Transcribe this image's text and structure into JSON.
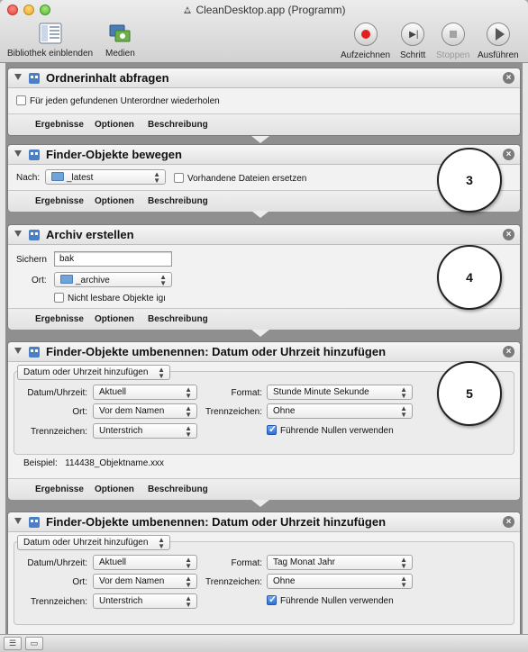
{
  "window": {
    "title": "CleanDesktop.app (Programm)"
  },
  "toolbar": {
    "library": "Bibliothek einblenden",
    "media": "Medien",
    "record": "Aufzeichnen",
    "step": "Schritt",
    "stop": "Stoppen",
    "run": "Ausführen"
  },
  "footer_tabs": {
    "results": "Ergebnisse",
    "options": "Optionen",
    "description": "Beschreibung"
  },
  "action1": {
    "title": "Ordnerinhalt abfragen",
    "repeat_checkbox": "Für jeden gefundenen Unterordner wiederholen",
    "repeat_checked": false
  },
  "action2": {
    "title": "Finder-Objekte bewegen",
    "to_label": "Nach:",
    "to_value": "_latest",
    "replace_checkbox": "Vorhandene Dateien ersetzen",
    "replace_checked": false,
    "step_number": "3"
  },
  "action3": {
    "title": "Archiv erstellen",
    "save_label": "Sichern",
    "save_value": "bak",
    "location_label": "Ort:",
    "location_value": "_archive",
    "unreadable_checkbox": "Nicht lesbare Objekte igı",
    "unreadable_checked": false,
    "step_number": "4"
  },
  "action4": {
    "title": "Finder-Objekte umbenennen: Datum oder Uhrzeit hinzufügen",
    "mode": "Datum oder Uhrzeit hinzufügen",
    "datetime_label": "Datum/Uhrzeit:",
    "datetime_value": "Aktuell",
    "position_label": "Ort:",
    "position_value": "Vor dem Namen",
    "separator_label": "Trennzeichen:",
    "separator_value": "Unterstrich",
    "format_label": "Format:",
    "format_value": "Stunde Minute Sekunde",
    "separator2_label": "Trennzeichen:",
    "separator2_value": "Ohne",
    "leading_zeros": "Führende Nullen verwenden",
    "leading_zeros_checked": true,
    "example_label": "Beispiel:",
    "example_value": "114438_Objektname.xxx",
    "step_number": "5"
  },
  "action5": {
    "title": "Finder-Objekte umbenennen: Datum oder Uhrzeit hinzufügen",
    "mode": "Datum oder Uhrzeit hinzufügen",
    "datetime_label": "Datum/Uhrzeit:",
    "datetime_value": "Aktuell",
    "position_label": "Ort:",
    "position_value": "Vor dem Namen",
    "separator_label": "Trennzeichen:",
    "separator_value": "Unterstrich",
    "format_label": "Format:",
    "format_value": "Tag Monat Jahr",
    "separator2_label": "Trennzeichen:",
    "separator2_value": "Ohne",
    "leading_zeros": "Führende Nullen verwenden",
    "leading_zeros_checked": true
  },
  "colors": {
    "record": "#e0201e",
    "accent": "#2d6fd6"
  }
}
